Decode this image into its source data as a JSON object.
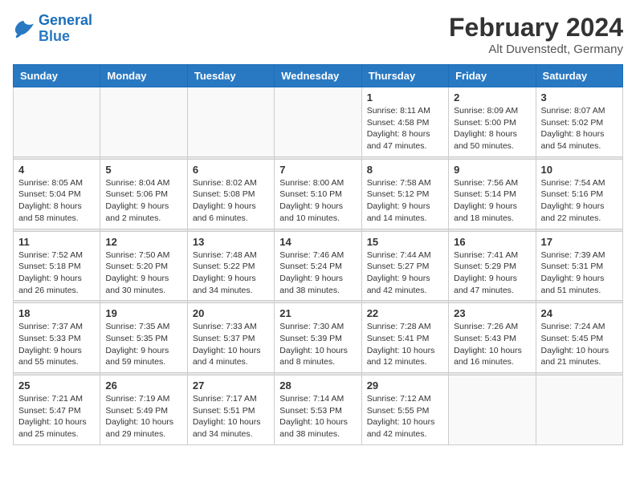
{
  "header": {
    "logo_line1": "General",
    "logo_line2": "Blue",
    "month_title": "February 2024",
    "location": "Alt Duvenstedt, Germany"
  },
  "weekdays": [
    "Sunday",
    "Monday",
    "Tuesday",
    "Wednesday",
    "Thursday",
    "Friday",
    "Saturday"
  ],
  "weeks": [
    [
      {
        "day": "",
        "info": ""
      },
      {
        "day": "",
        "info": ""
      },
      {
        "day": "",
        "info": ""
      },
      {
        "day": "",
        "info": ""
      },
      {
        "day": "1",
        "info": "Sunrise: 8:11 AM\nSunset: 4:58 PM\nDaylight: 8 hours\nand 47 minutes."
      },
      {
        "day": "2",
        "info": "Sunrise: 8:09 AM\nSunset: 5:00 PM\nDaylight: 8 hours\nand 50 minutes."
      },
      {
        "day": "3",
        "info": "Sunrise: 8:07 AM\nSunset: 5:02 PM\nDaylight: 8 hours\nand 54 minutes."
      }
    ],
    [
      {
        "day": "4",
        "info": "Sunrise: 8:05 AM\nSunset: 5:04 PM\nDaylight: 8 hours\nand 58 minutes."
      },
      {
        "day": "5",
        "info": "Sunrise: 8:04 AM\nSunset: 5:06 PM\nDaylight: 9 hours\nand 2 minutes."
      },
      {
        "day": "6",
        "info": "Sunrise: 8:02 AM\nSunset: 5:08 PM\nDaylight: 9 hours\nand 6 minutes."
      },
      {
        "day": "7",
        "info": "Sunrise: 8:00 AM\nSunset: 5:10 PM\nDaylight: 9 hours\nand 10 minutes."
      },
      {
        "day": "8",
        "info": "Sunrise: 7:58 AM\nSunset: 5:12 PM\nDaylight: 9 hours\nand 14 minutes."
      },
      {
        "day": "9",
        "info": "Sunrise: 7:56 AM\nSunset: 5:14 PM\nDaylight: 9 hours\nand 18 minutes."
      },
      {
        "day": "10",
        "info": "Sunrise: 7:54 AM\nSunset: 5:16 PM\nDaylight: 9 hours\nand 22 minutes."
      }
    ],
    [
      {
        "day": "11",
        "info": "Sunrise: 7:52 AM\nSunset: 5:18 PM\nDaylight: 9 hours\nand 26 minutes."
      },
      {
        "day": "12",
        "info": "Sunrise: 7:50 AM\nSunset: 5:20 PM\nDaylight: 9 hours\nand 30 minutes."
      },
      {
        "day": "13",
        "info": "Sunrise: 7:48 AM\nSunset: 5:22 PM\nDaylight: 9 hours\nand 34 minutes."
      },
      {
        "day": "14",
        "info": "Sunrise: 7:46 AM\nSunset: 5:24 PM\nDaylight: 9 hours\nand 38 minutes."
      },
      {
        "day": "15",
        "info": "Sunrise: 7:44 AM\nSunset: 5:27 PM\nDaylight: 9 hours\nand 42 minutes."
      },
      {
        "day": "16",
        "info": "Sunrise: 7:41 AM\nSunset: 5:29 PM\nDaylight: 9 hours\nand 47 minutes."
      },
      {
        "day": "17",
        "info": "Sunrise: 7:39 AM\nSunset: 5:31 PM\nDaylight: 9 hours\nand 51 minutes."
      }
    ],
    [
      {
        "day": "18",
        "info": "Sunrise: 7:37 AM\nSunset: 5:33 PM\nDaylight: 9 hours\nand 55 minutes."
      },
      {
        "day": "19",
        "info": "Sunrise: 7:35 AM\nSunset: 5:35 PM\nDaylight: 9 hours\nand 59 minutes."
      },
      {
        "day": "20",
        "info": "Sunrise: 7:33 AM\nSunset: 5:37 PM\nDaylight: 10 hours\nand 4 minutes."
      },
      {
        "day": "21",
        "info": "Sunrise: 7:30 AM\nSunset: 5:39 PM\nDaylight: 10 hours\nand 8 minutes."
      },
      {
        "day": "22",
        "info": "Sunrise: 7:28 AM\nSunset: 5:41 PM\nDaylight: 10 hours\nand 12 minutes."
      },
      {
        "day": "23",
        "info": "Sunrise: 7:26 AM\nSunset: 5:43 PM\nDaylight: 10 hours\nand 16 minutes."
      },
      {
        "day": "24",
        "info": "Sunrise: 7:24 AM\nSunset: 5:45 PM\nDaylight: 10 hours\nand 21 minutes."
      }
    ],
    [
      {
        "day": "25",
        "info": "Sunrise: 7:21 AM\nSunset: 5:47 PM\nDaylight: 10 hours\nand 25 minutes."
      },
      {
        "day": "26",
        "info": "Sunrise: 7:19 AM\nSunset: 5:49 PM\nDaylight: 10 hours\nand 29 minutes."
      },
      {
        "day": "27",
        "info": "Sunrise: 7:17 AM\nSunset: 5:51 PM\nDaylight: 10 hours\nand 34 minutes."
      },
      {
        "day": "28",
        "info": "Sunrise: 7:14 AM\nSunset: 5:53 PM\nDaylight: 10 hours\nand 38 minutes."
      },
      {
        "day": "29",
        "info": "Sunrise: 7:12 AM\nSunset: 5:55 PM\nDaylight: 10 hours\nand 42 minutes."
      },
      {
        "day": "",
        "info": ""
      },
      {
        "day": "",
        "info": ""
      }
    ]
  ]
}
